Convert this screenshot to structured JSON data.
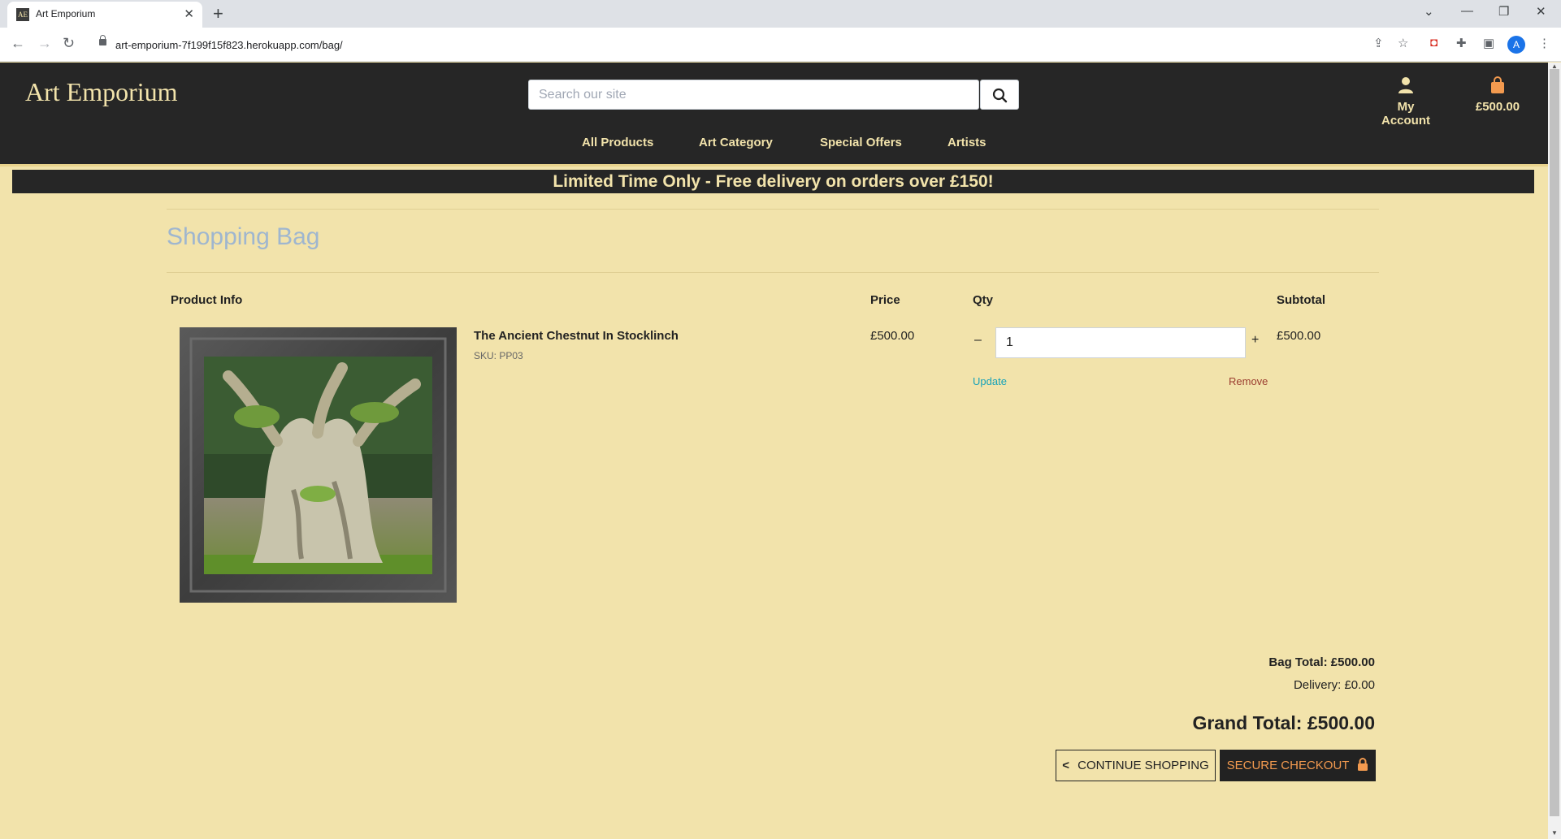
{
  "browser": {
    "tab_title": "Art Emporium",
    "tab_favicon_text": "AE",
    "url": "art-emporium-7f199f15f823.herokuapp.com/bag/",
    "profile_initial": "A"
  },
  "header": {
    "logo": "Art Emporium",
    "search_placeholder": "Search our site",
    "account_label": "My Account",
    "bag_total": "£500.00"
  },
  "nav": {
    "items": [
      "All Products",
      "Art Category",
      "Special Offers",
      "Artists"
    ]
  },
  "banner": "Limited Time Only - Free delivery on orders over £150!",
  "page": {
    "title": "Shopping Bag",
    "columns": {
      "product": "Product Info",
      "price": "Price",
      "qty": "Qty",
      "subtotal": "Subtotal"
    }
  },
  "item": {
    "name": "The Ancient Chestnut In Stocklinch",
    "sku": "SKU: PP03",
    "price": "£500.00",
    "qty": "1",
    "minus": "–",
    "plus": "+",
    "subtotal": "£500.00",
    "update": "Update",
    "remove": "Remove"
  },
  "totals": {
    "bag_total": "Bag Total: £500.00",
    "delivery": "Delivery: £0.00",
    "grand_total": "Grand Total: £500.00"
  },
  "buttons": {
    "continue": "CONTINUE SHOPPING",
    "checkout": "SECURE CHECKOUT"
  },
  "colors": {
    "page_bg": "#f2e3ab",
    "header_bg": "#262626",
    "title_blue": "#9fb6cf",
    "accent_orange": "#f39a4f",
    "update_teal": "#17a2b8",
    "remove_red": "#9b3d2f"
  }
}
